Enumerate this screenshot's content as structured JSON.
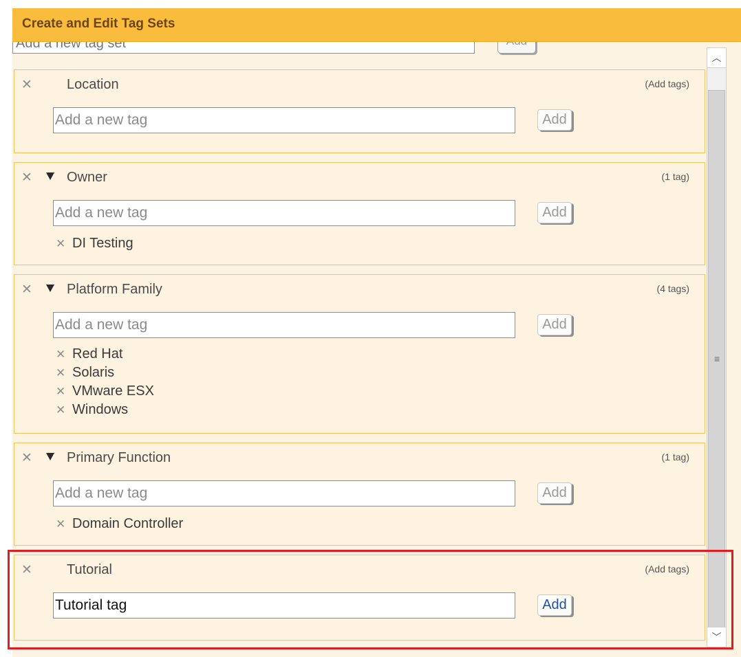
{
  "header": {
    "title": "Create and Edit Tag Sets"
  },
  "new_set": {
    "placeholder": "Add a new tag set",
    "add_label": "Add"
  },
  "tag_sets": [
    {
      "name": "Location",
      "count": "(Add tags)",
      "input_value": "Add a new tag",
      "add_label": "Add",
      "tags": []
    },
    {
      "name": "Owner",
      "count": "(1 tag)",
      "input_value": "Add a new tag",
      "add_label": "Add",
      "tags": [
        "DI Testing"
      ]
    },
    {
      "name": "Platform Family",
      "count": "(4 tags)",
      "input_value": "Add a new tag",
      "add_label": "Add",
      "tags": [
        "Red Hat",
        "Solaris",
        "VMware ESX",
        "Windows"
      ]
    },
    {
      "name": "Primary Function",
      "count": "(1 tag)",
      "input_value": "Add a new tag",
      "add_label": "Add",
      "tags": [
        "Domain Controller"
      ]
    },
    {
      "name": "Tutorial",
      "count": "(Add tags)",
      "input_value": "Tutorial tag",
      "add_label": "Add",
      "tags": []
    }
  ],
  "icons": {
    "remove": "close-icon",
    "collapse": "triangle-down-icon",
    "scroll_up": "chevron-up-icon",
    "scroll_down": "chevron-down-icon",
    "grip": "grip-icon"
  },
  "colors": {
    "header": "#f9bc3c",
    "highlight": "#e11d22",
    "panel": "#fdf3e2"
  }
}
